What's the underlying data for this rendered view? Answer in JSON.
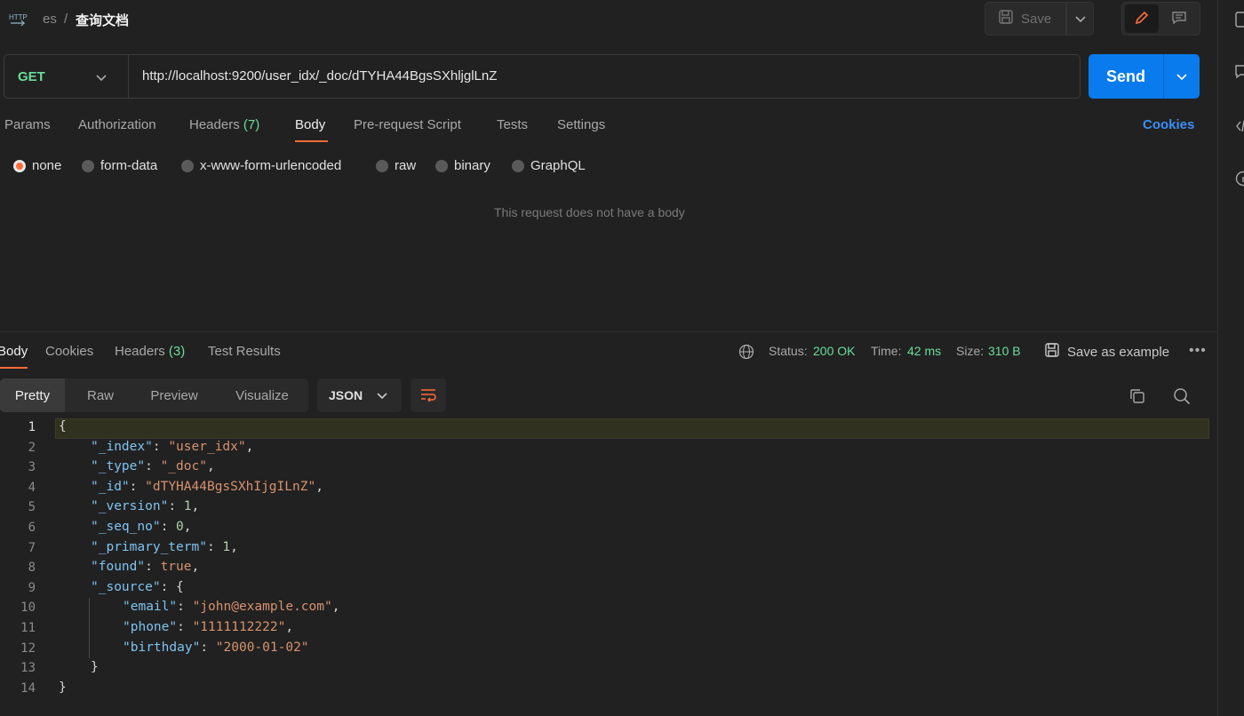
{
  "breadcrumb": {
    "workspace": "es",
    "separator": "/",
    "title": "查询文档"
  },
  "toolbar": {
    "save_label": "Save"
  },
  "request": {
    "method": "GET",
    "url": "http://localhost:9200/user_idx/_doc/dTYHA44BgsSXhljglLnZ",
    "send_label": "Send"
  },
  "request_tabs": {
    "params": "Params",
    "authorization": "Authorization",
    "headers": "Headers",
    "headers_count": "(7)",
    "body": "Body",
    "prerequest": "Pre-request Script",
    "tests": "Tests",
    "settings": "Settings",
    "cookies": "Cookies"
  },
  "body_types": {
    "none": "none",
    "form_data": "form-data",
    "urlencoded": "x-www-form-urlencoded",
    "raw": "raw",
    "binary": "binary",
    "graphql": "GraphQL",
    "selected": "none"
  },
  "empty_body_message": "This request does not have a body",
  "response_tabs": {
    "body": "Body",
    "cookies": "Cookies",
    "headers": "Headers",
    "headers_count": "(3)",
    "test_results": "Test Results"
  },
  "response_meta": {
    "status_label": "Status:",
    "status_value": "200 OK",
    "time_label": "Time:",
    "time_value": "42 ms",
    "size_label": "Size:",
    "size_value": "310 B",
    "save_example": "Save as example",
    "more": "•••"
  },
  "view_modes": {
    "pretty": "Pretty",
    "raw": "Raw",
    "preview": "Preview",
    "visualize": "Visualize",
    "format": "JSON"
  },
  "code_lines": [
    {
      "n": "1",
      "text": "{"
    },
    {
      "n": "2",
      "key": "\"_index\"",
      "val": "\"user_idx\"",
      "type": "s"
    },
    {
      "n": "3",
      "key": "\"_type\"",
      "val": "\"_doc\"",
      "type": "s"
    },
    {
      "n": "4",
      "key": "\"_id\"",
      "val": "\"dTYHA44BgsSXhIjgILnZ\"",
      "type": "s"
    },
    {
      "n": "5",
      "key": "\"_version\"",
      "val": "1",
      "type": "n"
    },
    {
      "n": "6",
      "key": "\"_seq_no\"",
      "val": "0",
      "type": "n"
    },
    {
      "n": "7",
      "key": "\"_primary_term\"",
      "val": "1",
      "type": "n"
    },
    {
      "n": "8",
      "key": "\"found\"",
      "val": "true",
      "type": "b"
    },
    {
      "n": "9",
      "key": "\"_source\"",
      "val": "{",
      "type": "p",
      "open": true
    },
    {
      "n": "10",
      "key": "\"email\"",
      "val": "\"john@example.com\"",
      "type": "s",
      "nested": true
    },
    {
      "n": "11",
      "key": "\"phone\"",
      "val": "\"1111112222\"",
      "type": "s",
      "nested": true
    },
    {
      "n": "12",
      "key": "\"birthday\"",
      "val": "\"2000-01-02\"",
      "type": "s",
      "nested": true,
      "last": true
    },
    {
      "n": "13",
      "text": "}",
      "close_inner": true
    },
    {
      "n": "14",
      "text": "}"
    }
  ]
}
